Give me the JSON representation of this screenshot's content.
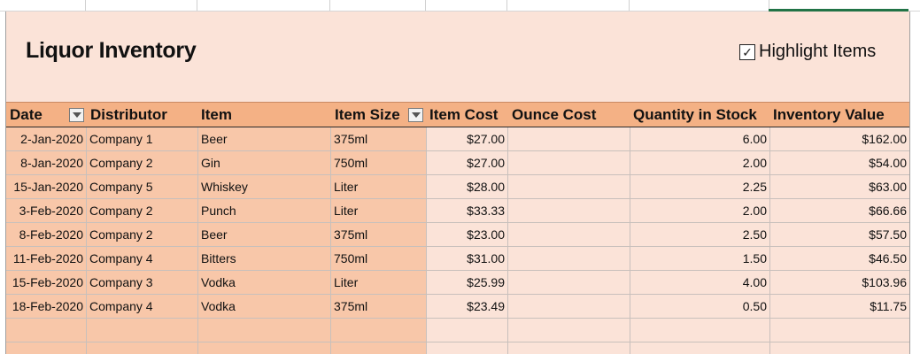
{
  "sheet": {
    "title": "Liquor Inventory",
    "highlight_checkbox": {
      "label": "Highlight Items",
      "checked": true,
      "mark": "✓"
    }
  },
  "table": {
    "headers": [
      "Date",
      "Distributor",
      "Item",
      "Item Size",
      "Item Cost",
      "Ounce Cost",
      "Quantity in Stock",
      "Inventory Value"
    ],
    "rows": [
      [
        "2-Jan-2020",
        "Company 1",
        "Beer",
        "375ml",
        "$27.00",
        "",
        "6.00",
        "$162.00"
      ],
      [
        "8-Jan-2020",
        "Company 2",
        "Gin",
        "750ml",
        "$27.00",
        "",
        "2.00",
        "$54.00"
      ],
      [
        "15-Jan-2020",
        "Company 5",
        "Whiskey",
        "Liter",
        "$28.00",
        "",
        "2.25",
        "$63.00"
      ],
      [
        "3-Feb-2020",
        "Company 2",
        "Punch",
        "Liter",
        "$33.33",
        "",
        "2.00",
        "$66.66"
      ],
      [
        "8-Feb-2020",
        "Company 2",
        "Beer",
        "375ml",
        "$23.00",
        "",
        "2.50",
        "$57.50"
      ],
      [
        "11-Feb-2020",
        "Company 4",
        "Bitters",
        "750ml",
        "$31.00",
        "",
        "1.50",
        "$46.50"
      ],
      [
        "15-Feb-2020",
        "Company 3",
        "Vodka",
        "Liter",
        "$25.99",
        "",
        "4.00",
        "$103.96"
      ],
      [
        "18-Feb-2020",
        "Company 4",
        "Vodka",
        "375ml",
        "$23.49",
        "",
        "0.50",
        "$11.75"
      ]
    ]
  },
  "colors": {
    "header_fill": "#f4b185",
    "banded_fill": "#f8c7a9",
    "body_fill": "#fbe3d8",
    "selection_accent": "#217346"
  }
}
